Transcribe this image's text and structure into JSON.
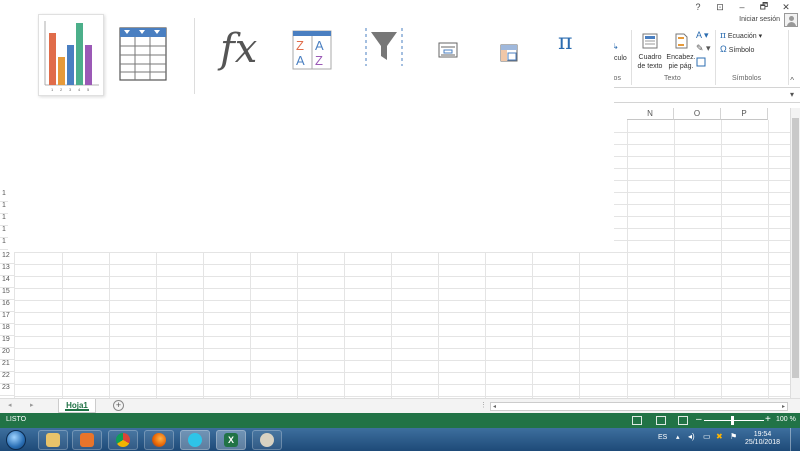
{
  "window": {
    "help": "?",
    "ribbon_options": "⊡",
    "minimize": "–",
    "restore": "🗗",
    "close": "✕",
    "signin": "Iniciar sesión"
  },
  "ribbon": {
    "partial_left_top": "ículo",
    "partial_group_label": "los",
    "cuadro_texto": "Cuadro\nde texto",
    "encabezado": "Encabez.\npie pág.",
    "texto_group": "Texto",
    "ecuacion": "Ecuación",
    "simbolo": "Símbolo",
    "simbolos_group": "Símbolos",
    "collapse": "^"
  },
  "columns": [
    "N",
    "O",
    "P"
  ],
  "rows": [
    "1",
    "1",
    "1",
    "1",
    "1",
    "12",
    "13",
    "14",
    "15",
    "16",
    "17",
    "18",
    "19",
    "20",
    "21",
    "22",
    "23"
  ],
  "sheets": {
    "active": "Hoja1",
    "add": "+"
  },
  "status": {
    "ready": "LISTO",
    "zoom_minus": "–",
    "zoom_plus": "+",
    "zoom": "100 %"
  },
  "taskbar": {
    "lang": "ES",
    "time": "19:54",
    "date": "25/10/2018"
  },
  "overlay_icons": {
    "chart": "chart-icon",
    "table": "table-icon",
    "function": "fx",
    "sort": {
      "top": "Z",
      "bottom": "A",
      "top2": "A",
      "bottom2": "Z"
    },
    "filter": "filter-icon",
    "form": "form-icon",
    "pivot": "pivot-icon",
    "pi": "π"
  },
  "colors": {
    "excel_green": "#217346",
    "bar1": "#e06c4a",
    "bar2": "#e69a3a",
    "bar3": "#4a7fc1",
    "bar4": "#4caf8a",
    "bar5": "#9b59b6"
  }
}
